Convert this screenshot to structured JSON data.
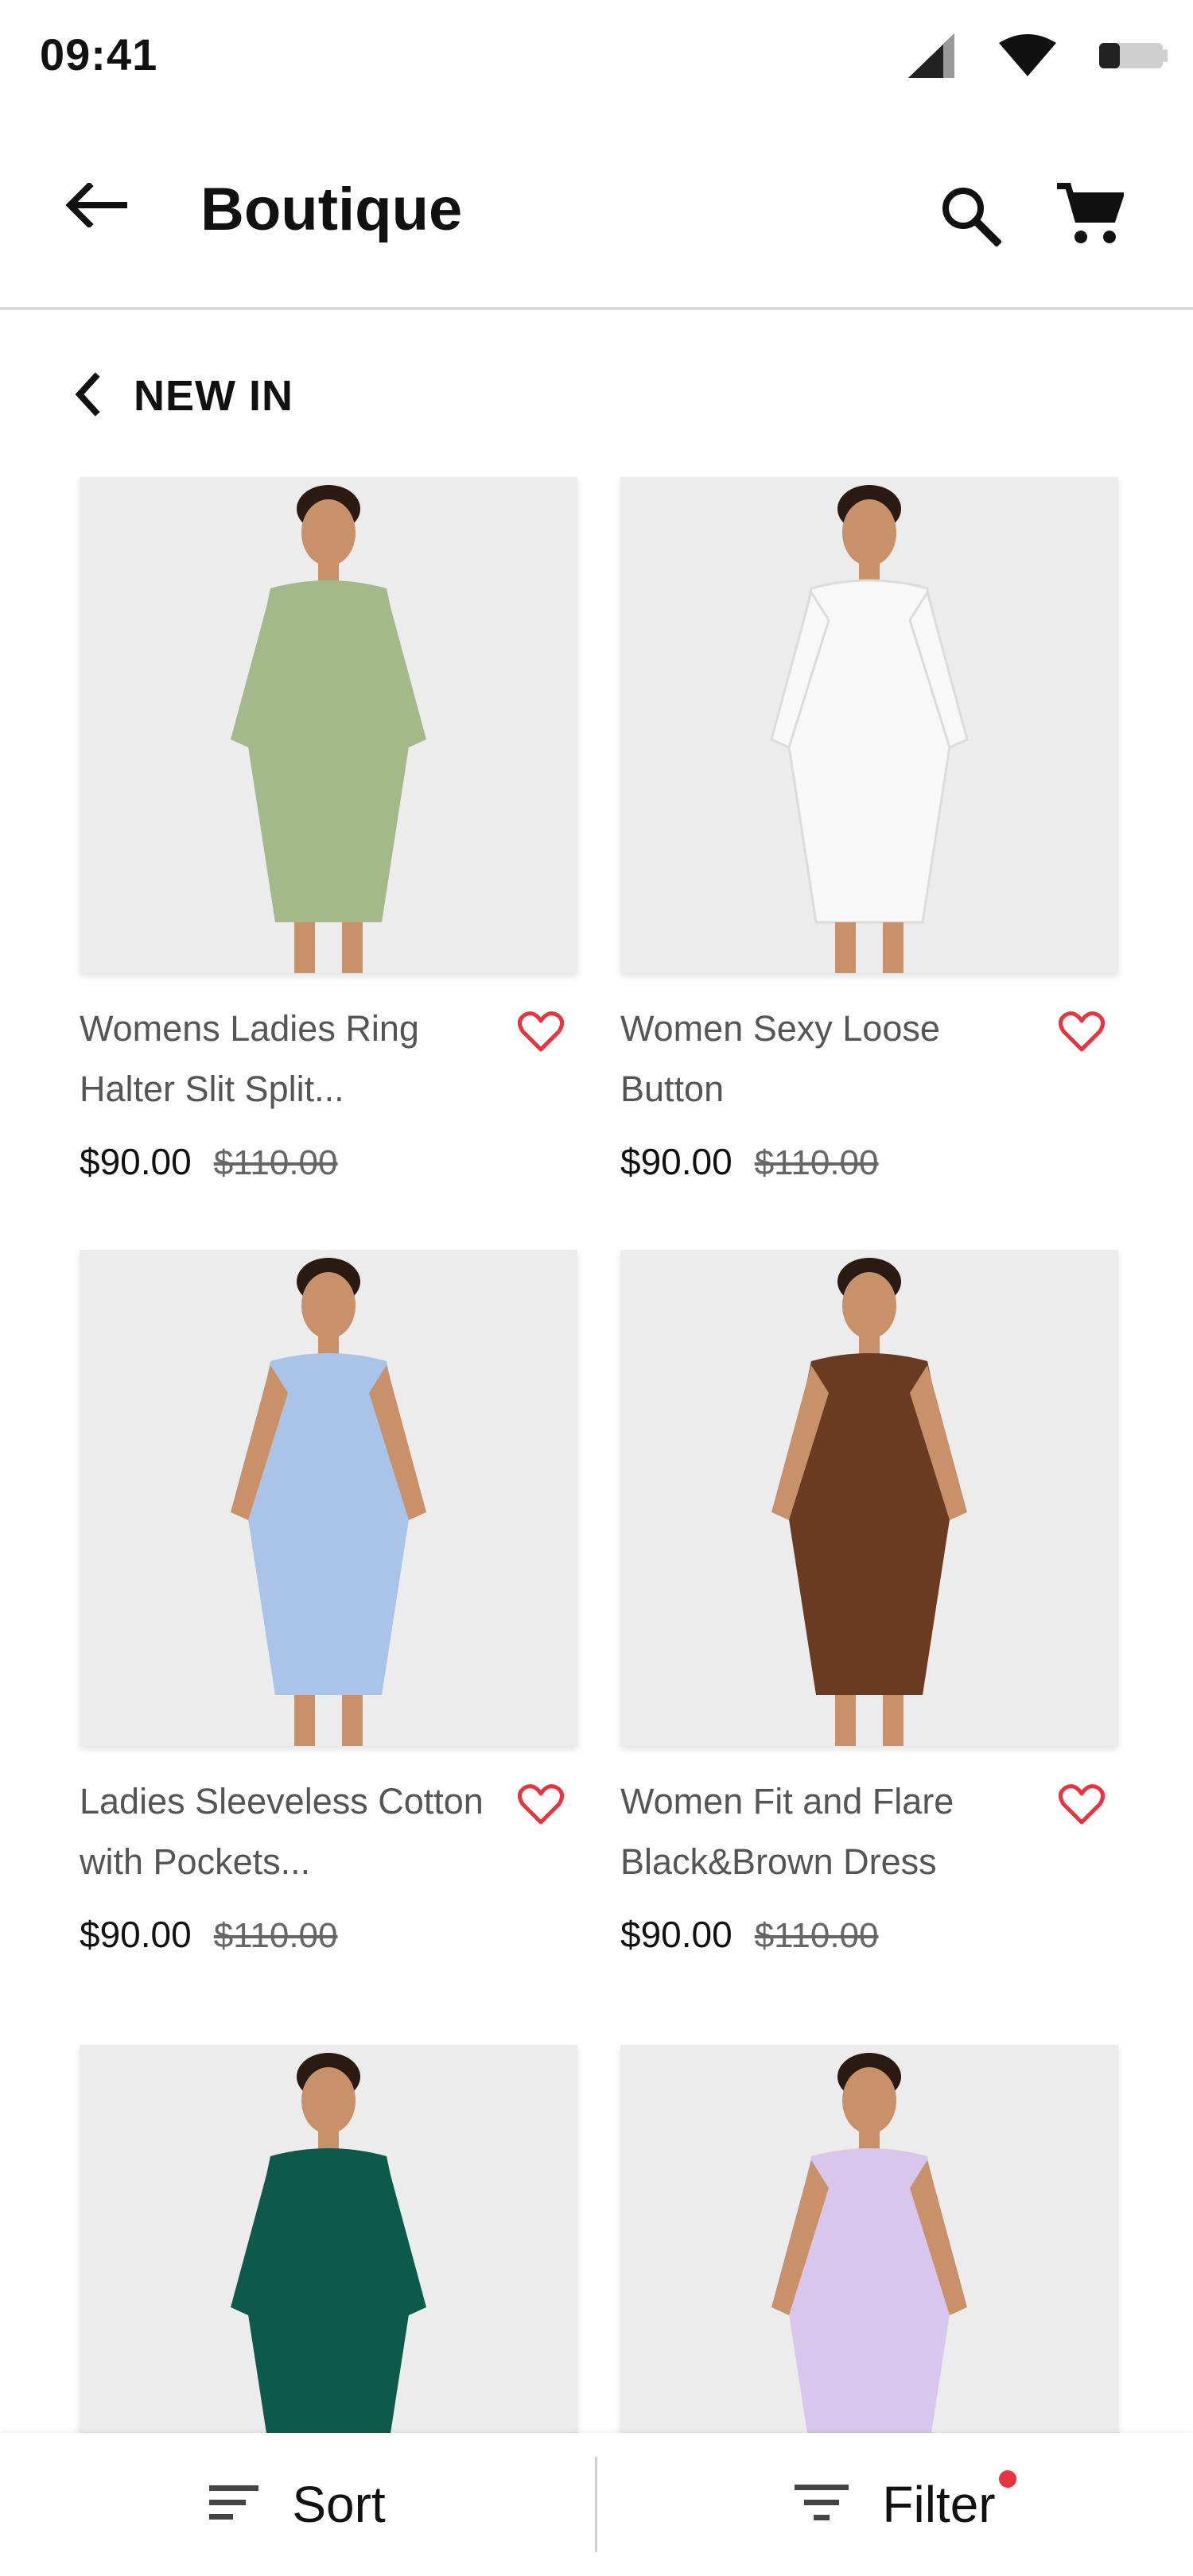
{
  "status_bar": {
    "time": "09:41",
    "icons": [
      "signal-icon",
      "wifi-icon",
      "battery-icon"
    ]
  },
  "app_bar": {
    "back_icon": "arrow-left-icon",
    "title": "Boutique",
    "search_icon": "search-icon",
    "cart_icon": "cart-icon"
  },
  "section": {
    "icon": "chevron-left-icon",
    "title": "NEW IN"
  },
  "products": [
    {
      "name": "Womens Ladies Ring Halter Slit Split...",
      "price": "$90.00",
      "original_price": "$110.00",
      "favorite_icon": "heart-outline-icon",
      "dress_color": "#a3b98a"
    },
    {
      "name": "Women Sexy Loose Button",
      "price": "$90.00",
      "original_price": "$110.00",
      "favorite_icon": "heart-outline-icon",
      "dress_color": "#f8f8f8"
    },
    {
      "name": "Ladies Sleeveless Cotton with Pockets...",
      "price": "$90.00",
      "original_price": "$110.00",
      "favorite_icon": "heart-outline-icon",
      "dress_color": "#a9c4e8"
    },
    {
      "name": "Women Fit and Flare Black&Brown Dress",
      "price": "$90.00",
      "original_price": "$110.00",
      "favorite_icon": "heart-outline-icon",
      "dress_color": "#6b3a22"
    },
    {
      "name": "",
      "price": "",
      "original_price": "",
      "favorite_icon": "",
      "dress_color": "#0e5a4a"
    },
    {
      "name": "",
      "price": "",
      "original_price": "",
      "favorite_icon": "",
      "dress_color": "#d9c6ec"
    }
  ],
  "bottom_bar": {
    "sort_label": "Sort",
    "sort_icon": "sort-icon",
    "filter_label": "Filter",
    "filter_icon": "filter-icon",
    "filter_badge_color": "#e8343f"
  },
  "colors": {
    "favorite": "#e8343f",
    "text_primary": "#111111",
    "text_secondary": "#555555",
    "image_bg": "#ececec"
  }
}
